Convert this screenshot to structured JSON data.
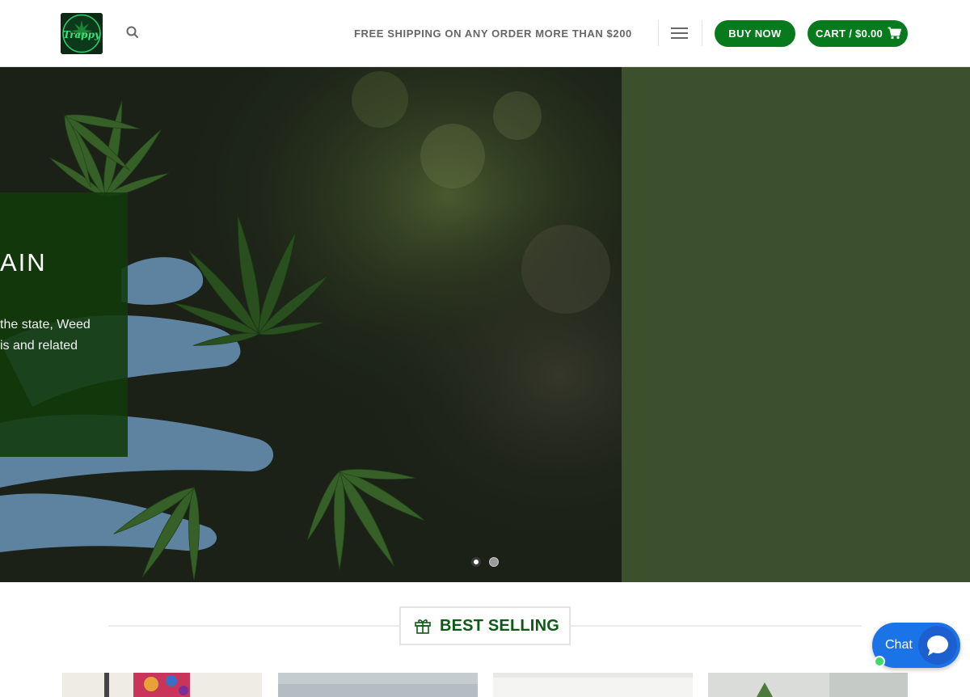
{
  "header": {
    "logo_alt": "Trappy Exotics logo",
    "logo_text": "Trappy",
    "shipping_notice": "FREE SHIPPING ON ANY ORDER MORE THAN $200",
    "buy_now_label": "BUY NOW",
    "cart_label": "CART / $0.00",
    "icons": {
      "search": "search-icon",
      "menu": "hamburger-menu-icon",
      "cart": "shopping-cart-icon"
    }
  },
  "hero": {
    "title_visible": "AIN",
    "line1_visible": "the state, Weed",
    "line2_visible": "is and related",
    "slides": [
      {
        "active": true
      },
      {
        "active": false
      }
    ]
  },
  "best_selling": {
    "heading": "BEST SELLING",
    "icon": "gift-icon"
  },
  "chat": {
    "label": "Chat",
    "icon": "chat-bubble-icon",
    "status": "online"
  },
  "colors": {
    "brand_green": "#087a1e",
    "heading_green": "#0d5a14",
    "hero_side": "#3d502d",
    "chat_blue": "#1b73e8"
  }
}
